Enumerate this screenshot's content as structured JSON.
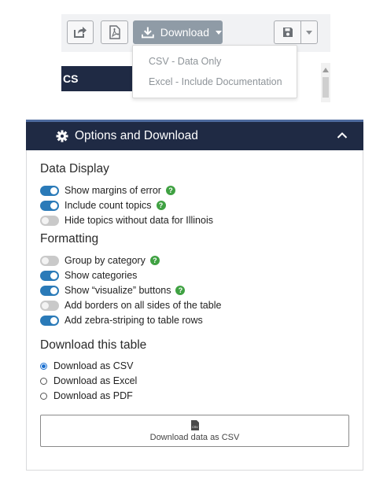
{
  "toolbar": {
    "download_label": "Download",
    "dropdown": {
      "csv_option": "CSV - Data Only",
      "excel_option": "Excel - Include Documentation"
    },
    "band_text": "CS"
  },
  "panel": {
    "title": "Options and Download",
    "data_display": {
      "heading": "Data Display",
      "options": [
        {
          "label": "Show margins of error",
          "on": true,
          "help": true
        },
        {
          "label": "Include count topics",
          "on": true,
          "help": true
        },
        {
          "label": "Hide topics without data for Illinois",
          "on": false,
          "help": false
        }
      ]
    },
    "formatting": {
      "heading": "Formatting",
      "options": [
        {
          "label": "Group by category",
          "on": false,
          "help": true
        },
        {
          "label": "Show categories",
          "on": true,
          "help": false
        },
        {
          "label": "Show “visualize” buttons",
          "on": true,
          "help": true
        },
        {
          "label": "Add borders on all sides of the table",
          "on": false,
          "help": false
        },
        {
          "label": "Add zebra-striping to table rows",
          "on": true,
          "help": false
        }
      ]
    },
    "download": {
      "heading": "Download this table",
      "options": [
        {
          "label": "Download as CSV",
          "checked": true
        },
        {
          "label": "Download as Excel",
          "checked": false
        },
        {
          "label": "Download as PDF",
          "checked": false
        }
      ],
      "button_label": "Download data as CSV",
      "button_icon_text": "CSV"
    },
    "help_glyph": "?"
  },
  "icons": {
    "share": "share-icon",
    "pdf": "pdf-icon",
    "download": "download-icon",
    "save": "save-icon",
    "gear": "gear-icon",
    "chevron": "chevron-up-icon",
    "csv_file": "csv-file-icon"
  },
  "colors": {
    "navy": "#1f2a44",
    "toggle_on": "#2a7ab8",
    "help_green": "#3fa142",
    "download_button": "#8f9ba6"
  }
}
